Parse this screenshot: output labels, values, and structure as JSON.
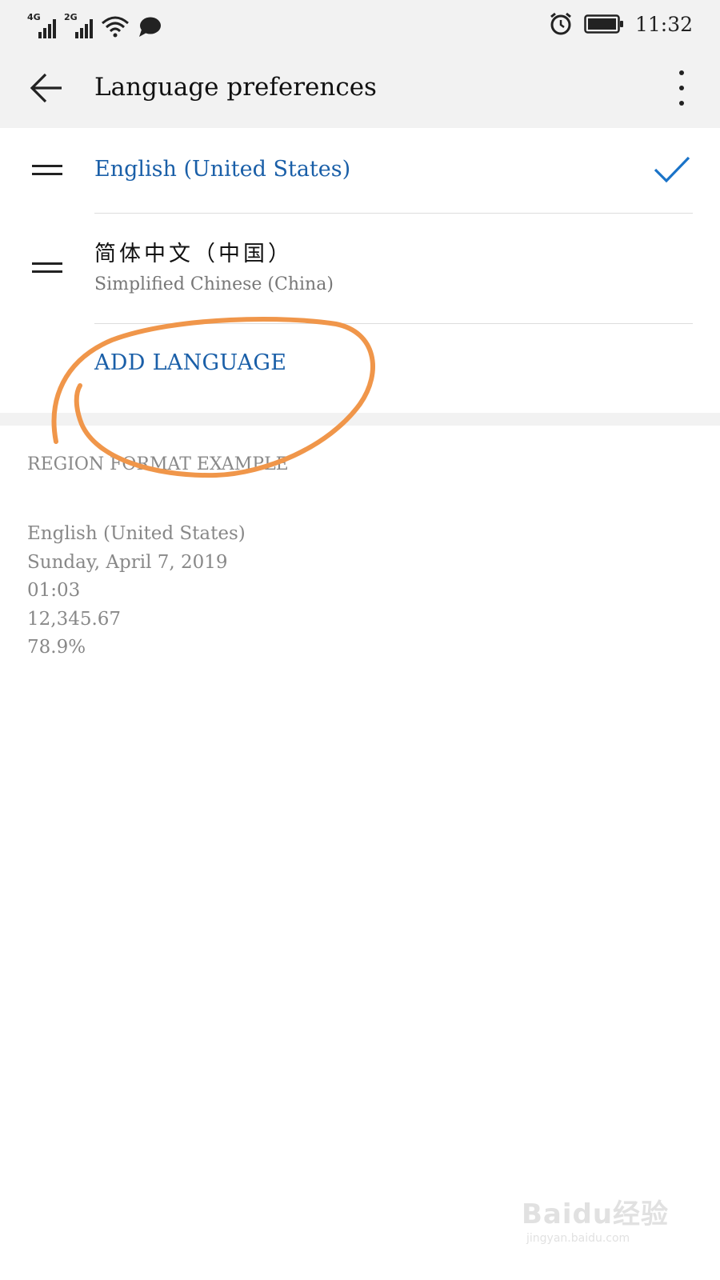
{
  "status_bar": {
    "network_1": "4G",
    "network_2": "2G",
    "time": "11:32",
    "icons": [
      "signal-icon",
      "wifi-icon",
      "message-bubble-icon",
      "alarm-icon",
      "battery-icon"
    ]
  },
  "app_bar": {
    "title": "Language preferences",
    "back_icon": "arrow-left-icon",
    "more_icon": "more-vertical-icon"
  },
  "languages": [
    {
      "primary": "English (United States)",
      "secondary": "",
      "selected": true
    },
    {
      "primary": "简体中文（中国）",
      "secondary": "Simplified Chinese (China)",
      "selected": false
    }
  ],
  "add_language_label": "ADD LANGUAGE",
  "region_format": {
    "header": "REGION FORMAT EXAMPLE",
    "lines": [
      "English (United States)",
      "Sunday, April 7, 2019",
      "01:03",
      "12,345.67",
      "78.9%"
    ]
  },
  "watermark": {
    "brand": "Baidu经验",
    "url": "jingyan.baidu.com"
  },
  "colors": {
    "accent": "#1a5fa8",
    "annotation": "#f0964a"
  }
}
